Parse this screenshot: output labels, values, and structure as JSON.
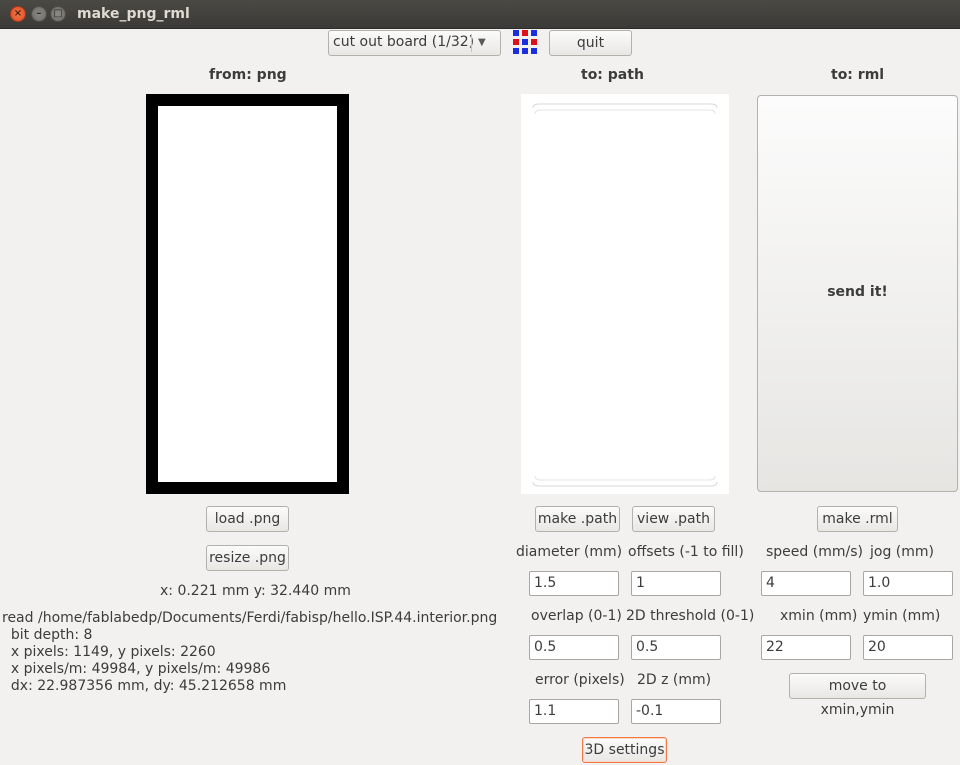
{
  "window": {
    "title": "make_png_rml"
  },
  "toolbar": {
    "process_selected": "cut out board (1/32)",
    "quit_label": "quit"
  },
  "headers": {
    "from": "from: png",
    "to_path": "to: path",
    "to_rml": "to: rml"
  },
  "png_panel": {
    "load_label": "load .png",
    "resize_label": "resize .png",
    "coords": "x: 0.221 mm  y: 32.440 mm",
    "info_lines": [
      "read /home/fablabedp/Documents/Ferdi/fabisp/hello.ISP.44.interior.png",
      "  bit depth: 8",
      "  x pixels: 1149, y pixels: 2260",
      "  x pixels/m: 49984, y pixels/m: 49986",
      "  dx: 22.987356 mm, dy: 45.212658 mm"
    ]
  },
  "path_panel": {
    "make_label": "make .path",
    "view_label": "view .path",
    "diameter_label": "diameter (mm)",
    "diameter_value": "1.5",
    "offsets_label": "offsets (-1 to fill)",
    "offsets_value": "1",
    "overlap_label": "overlap (0-1)",
    "overlap_value": "0.5",
    "threshold_label": "2D threshold (0-1)",
    "threshold_value": "0.5",
    "error_label": "error (pixels)",
    "error_value": "1.1",
    "z_label": "2D z (mm)",
    "z_value": "-0.1",
    "settings_3d_label": "3D settings"
  },
  "rml_panel": {
    "send_label": "send it!",
    "make_label": "make .rml",
    "speed_label": "speed (mm/s)",
    "speed_value": "4",
    "jog_label": "jog (mm)",
    "jog_value": "1.0",
    "xmin_label": "xmin (mm)",
    "xmin_value": "22",
    "ymin_label": "ymin (mm)",
    "ymin_value": "20",
    "move_label": "move to xmin,ymin"
  }
}
